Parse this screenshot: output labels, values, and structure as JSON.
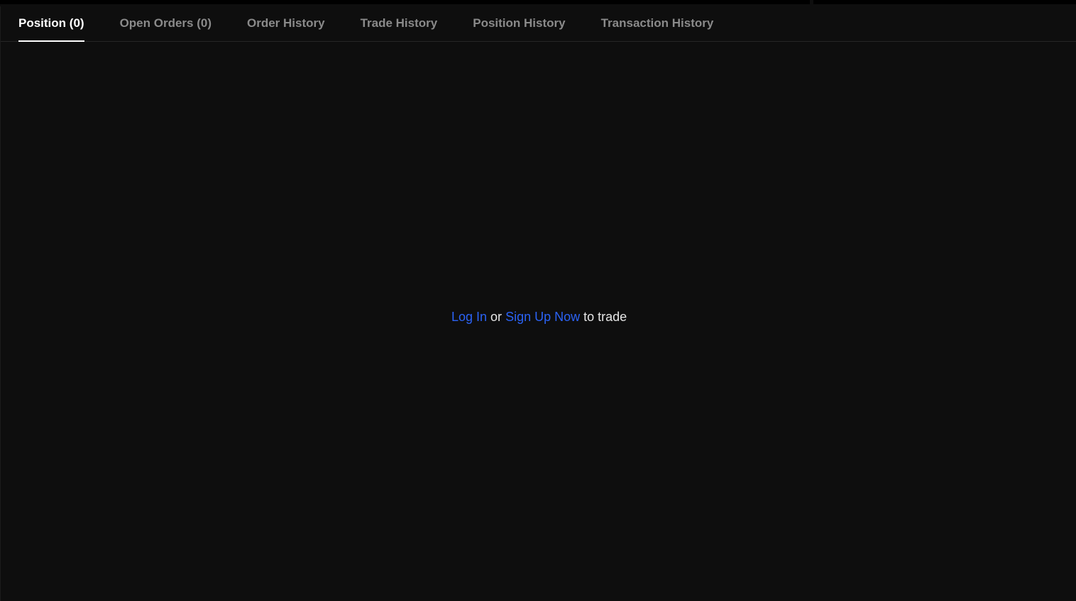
{
  "tabs": [
    {
      "label": "Position (0)",
      "active": true
    },
    {
      "label": "Open Orders (0)",
      "active": false
    },
    {
      "label": "Order History",
      "active": false
    },
    {
      "label": "Trade History",
      "active": false
    },
    {
      "label": "Position History",
      "active": false
    },
    {
      "label": "Transaction History",
      "active": false
    }
  ],
  "empty_state": {
    "login_link": "Log In",
    "or_text": " or ",
    "signup_link": "Sign Up Now",
    "suffix_text": " to trade"
  },
  "colors": {
    "background": "#0e0e0e",
    "link": "#2b63f5",
    "active_tab": "#ffffff",
    "inactive_tab": "#8a8a8a"
  }
}
